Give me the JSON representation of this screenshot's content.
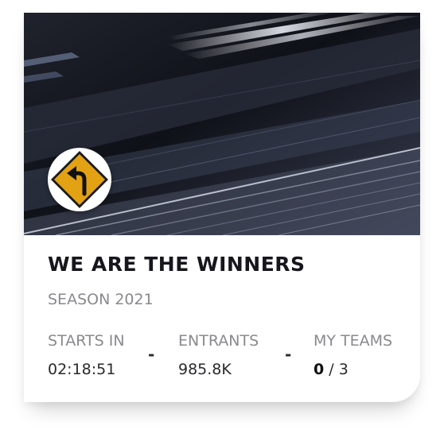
{
  "card": {
    "badge_icon": "left-turn-road-sign-icon",
    "title": "WE ARE THE WINNERS",
    "subtitle": "SEASON 2021"
  },
  "stats": {
    "starts_in": {
      "label": "STARTS IN",
      "value": "02:18:51"
    },
    "entrants": {
      "label": "ENTRANTS",
      "value": "985.8K"
    },
    "my_teams": {
      "label": "MY TEAMS",
      "current": "0",
      "separator": " / ",
      "max": "3"
    },
    "divider": "-"
  },
  "colors": {
    "title": "#16161c",
    "muted": "#8a8a8e",
    "sign_yellow": "#e3a213"
  }
}
